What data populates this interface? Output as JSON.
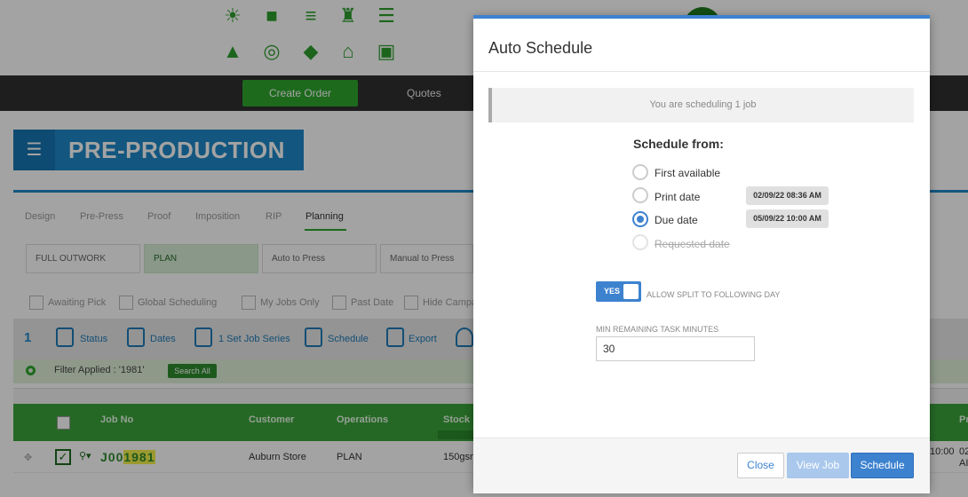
{
  "header": {
    "nav": {
      "create_order": "Create Order",
      "quotes": "Quotes"
    },
    "icons": [
      "lightbulb-icon",
      "briefcase-icon",
      "stack-icon",
      "trolley-icon",
      "document-list-icon",
      "upload-boxes-icon",
      "rolls-icon",
      "box-icon",
      "tent-icon",
      "printer-icon"
    ]
  },
  "page": {
    "title": "PRE-PRODUCTION",
    "tabs": [
      "Design",
      "Pre-Press",
      "Proof",
      "Imposition",
      "RIP",
      "Planning"
    ],
    "active_tab": "Planning",
    "subtabs": [
      "FULL OUTWORK",
      "PLAN",
      "Auto to Press",
      "Manual to Press"
    ],
    "active_subtab": "PLAN",
    "filters": [
      "Awaiting Pick",
      "Global Scheduling",
      "My Jobs Only",
      "Past Date",
      "Hide Campa"
    ],
    "toolbar": {
      "count": "1",
      "items": [
        "Status",
        "Dates",
        "1 Set Job Series",
        "Schedule",
        "Export"
      ]
    },
    "filter_applied": "Filter Applied : '1981'",
    "search_all": "Search All",
    "table": {
      "columns": [
        "Job No",
        "Customer",
        "Operations",
        "Stock"
      ],
      "right_columns": [
        "Pr"
      ],
      "row": {
        "job_prefix": "J00",
        "job_highlight": "1981",
        "customer": "Auburn Store",
        "operations": "PLAN",
        "stock": "150gsm",
        "right_time": "10:00",
        "right_partial": "02",
        "right_partial2": "AI"
      }
    }
  },
  "modal": {
    "title": "Auto Schedule",
    "info": "You are scheduling 1 job",
    "schedule_from": "Schedule from:",
    "options": [
      {
        "label": "First available",
        "state": "unchecked"
      },
      {
        "label": "Print date",
        "state": "unchecked",
        "date": "02/09/22 08:36 AM"
      },
      {
        "label": "Due date",
        "state": "checked",
        "date": "05/09/22 10:00 AM"
      },
      {
        "label": "Requested date",
        "state": "disabled"
      }
    ],
    "split_toggle": {
      "value": "YES",
      "label": "ALLOW SPLIT TO FOLLOWING DAY"
    },
    "min_task": {
      "label": "MIN REMAINING TASK MINUTES",
      "value": "30"
    },
    "buttons": {
      "close": "Close",
      "view_job": "View Job",
      "schedule": "Schedule"
    }
  },
  "colors": {
    "accent": "#3d82cf",
    "brand_green": "#2ea62e",
    "banner_blue": "#1e88c8"
  }
}
